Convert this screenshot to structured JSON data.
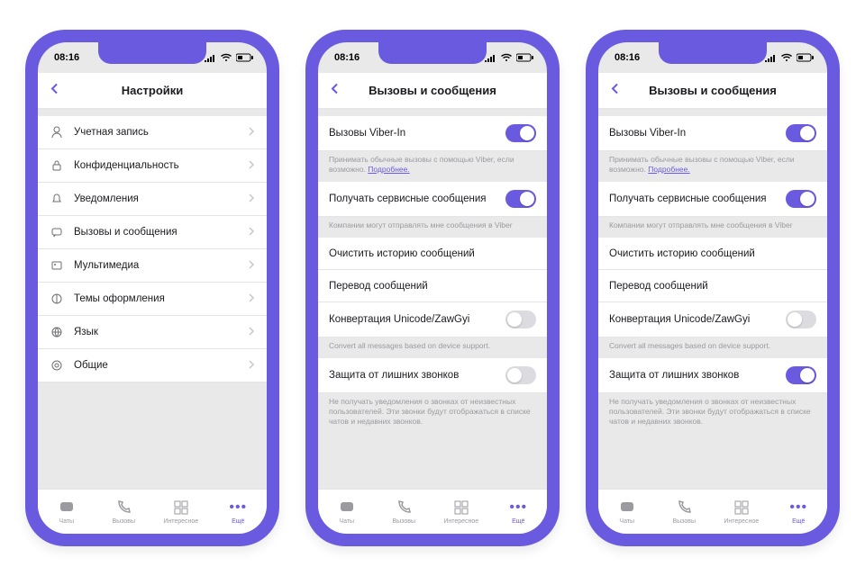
{
  "status_time": "08:16",
  "phones": [
    {
      "title": "Настройки",
      "menu_items": [
        {
          "icon": "person",
          "label": "Учетная запись"
        },
        {
          "icon": "lock",
          "label": "Конфиденциальность"
        },
        {
          "icon": "bell",
          "label": "Уведомления"
        },
        {
          "icon": "chat",
          "label": "Вызовы и сообщения"
        },
        {
          "icon": "media",
          "label": "Мультимедиа"
        },
        {
          "icon": "theme",
          "label": "Темы оформления"
        },
        {
          "icon": "globe",
          "label": "Язык"
        },
        {
          "icon": "gear",
          "label": "Общие"
        }
      ]
    },
    {
      "title": "Вызовы и сообщения",
      "items": [
        {
          "label": "Вызовы Viber-In",
          "toggle": true,
          "sub": "Принимать обычные вызовы с помощью Viber, если возможно. ",
          "link": "Подробнее."
        },
        {
          "label": "Получать сервисные сообщения",
          "toggle": true,
          "sub": "Компании могут отправлять мне сообщения в Viber"
        },
        {
          "label": "Очистить историю сообщений"
        },
        {
          "label": "Перевод сообщений"
        },
        {
          "label": "Конвертация Unicode/ZawGyi",
          "toggle": false,
          "sub": "Convert all messages based on device support."
        },
        {
          "label": "Защита от лишних звонков",
          "toggle": false,
          "sub": "Не получать уведомления о звонках от неизвестных пользователей. Эти звонки будут отображаться в списке чатов и недавних звонков."
        }
      ]
    },
    {
      "title": "Вызовы и сообщения",
      "items": [
        {
          "label": "Вызовы Viber-In",
          "toggle": true,
          "sub": "Принимать обычные вызовы с помощью Viber, если возможно. ",
          "link": "Подробнее."
        },
        {
          "label": "Получать сервисные сообщения",
          "toggle": true,
          "sub": "Компании могут отправлять мне сообщения в Viber"
        },
        {
          "label": "Очистить историю сообщений"
        },
        {
          "label": "Перевод сообщений"
        },
        {
          "label": "Конвертация Unicode/ZawGyi",
          "toggle": false,
          "sub": "Convert all messages based on device support."
        },
        {
          "label": "Защита от лишних звонков",
          "toggle": true,
          "sub": "Не получать уведомления о звонках от неизвестных пользователей. Эти звонки будут отображаться в списке чатов и недавних звонков."
        }
      ]
    }
  ],
  "tabs": [
    {
      "label": "Чаты",
      "icon": "chat"
    },
    {
      "label": "Вызовы",
      "icon": "phone"
    },
    {
      "label": "Интересное",
      "icon": "grid"
    },
    {
      "label": "Ещё",
      "icon": "more",
      "active": true
    }
  ]
}
